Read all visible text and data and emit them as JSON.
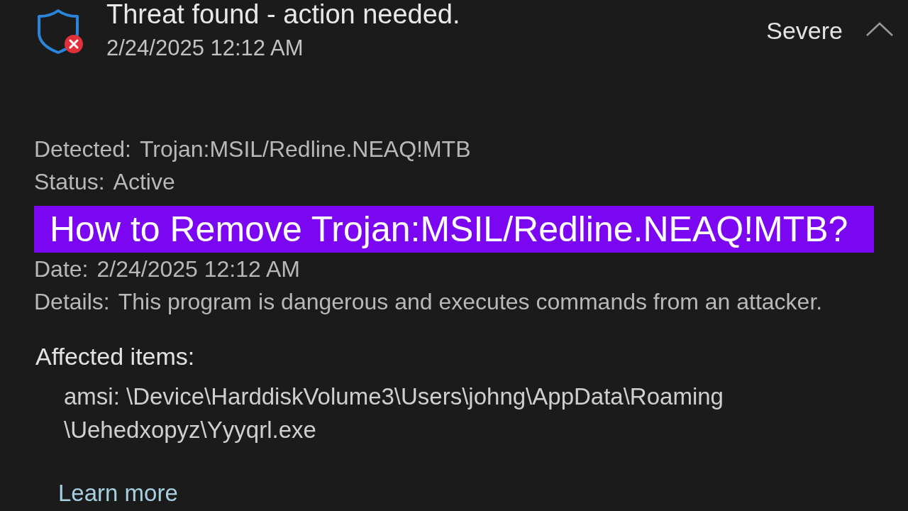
{
  "notification": {
    "title": "Threat found - action needed.",
    "timestamp": "2/24/2025 12:12 AM",
    "severity": "Severe",
    "expanded": true
  },
  "rows": [
    {
      "kind": "field",
      "label": "Detected:",
      "value": "Trojan:MSIL/Redline.NEAQ!MTB"
    },
    {
      "kind": "field",
      "label": "Status:",
      "value": "Active"
    },
    {
      "kind": "banner",
      "text": "How to Remove Trojan:MSIL/Redline.NEAQ!MTB?"
    },
    {
      "kind": "field",
      "label": "Date:",
      "value": "2/24/2025 12:12 AM"
    },
    {
      "kind": "field",
      "label": "Details:",
      "value": "This program is dangerous and executes commands from an attacker."
    }
  ],
  "affected_items": {
    "heading": "Affected items:",
    "path_lines": [
      "amsi: \\Device\\HarddiskVolume3\\Users\\johng\\AppData\\Roaming",
      "\\Uehedxopyz\\Yyyqrl.exe"
    ]
  },
  "learn_more_link": "Learn more"
}
